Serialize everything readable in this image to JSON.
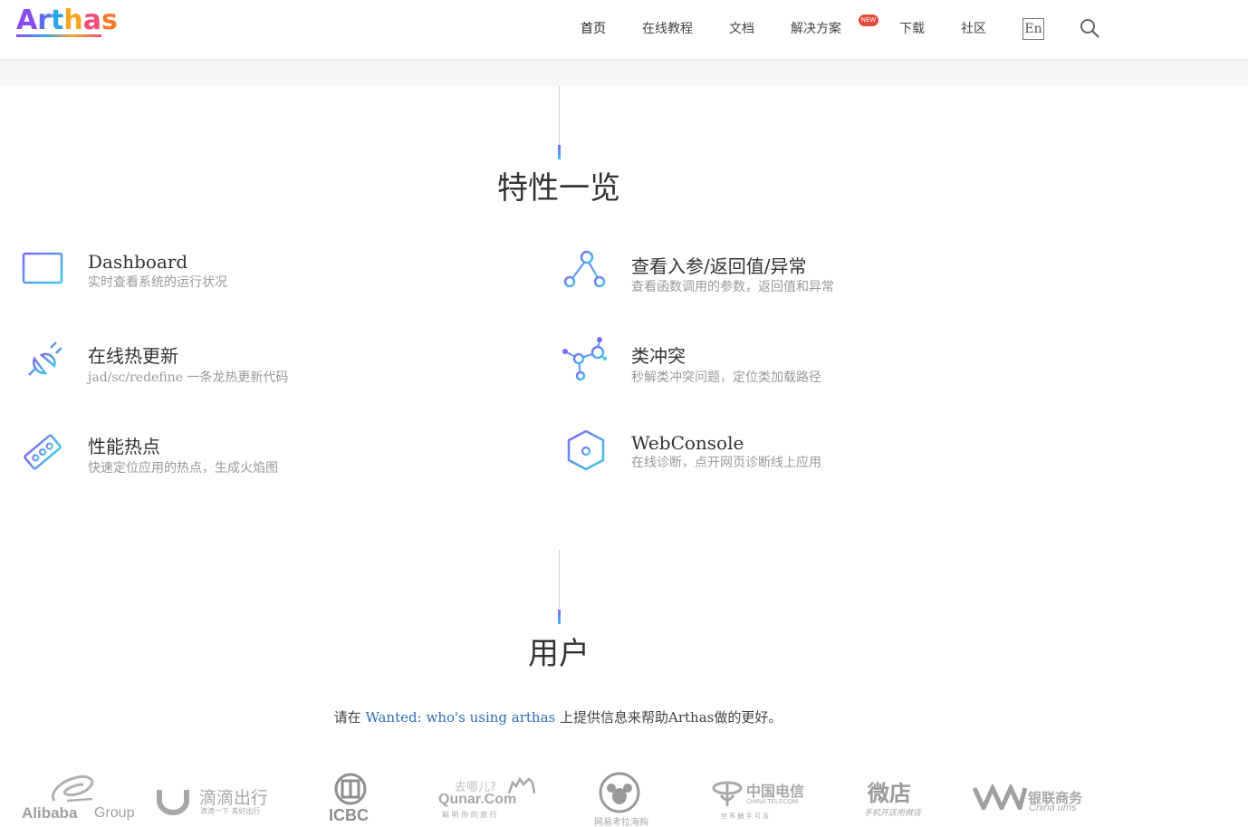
{
  "brand": {
    "name": "Arthas"
  },
  "nav": {
    "items": [
      "首页",
      "在线教程",
      "文档",
      "解决方案",
      "下载",
      "社区"
    ],
    "new_badge": "NEW",
    "lang": "En"
  },
  "features_section": {
    "title": "特性一览"
  },
  "features": [
    {
      "icon": "dashboard-icon",
      "title": "Dashboard",
      "desc": "实时查看系统的运行状况"
    },
    {
      "icon": "hot-update-icon",
      "title": "在线热更新",
      "desc": "jad/sc/redefine 一条龙热更新代码"
    },
    {
      "icon": "profiler-icon",
      "title": "性能热点",
      "desc": "快速定位应用的热点，生成火焰图"
    },
    {
      "icon": "watch-params-icon",
      "title": "查看入参/返回值/异常",
      "desc": "查看函数调用的参数，返回值和异常"
    },
    {
      "icon": "class-conflict-icon",
      "title": "类冲突",
      "desc": "秒解类冲突问题，定位类加载路径"
    },
    {
      "icon": "webconsole-icon",
      "title": "WebConsole",
      "desc": "在线诊断，点开网页诊断线上应用"
    }
  ],
  "users_section": {
    "title": "用户",
    "note_prefix": "请在 ",
    "note_link": "Wanted: who's using arthas",
    "note_suffix": " 上提供信息来帮助Arthas做的更好。"
  },
  "user_logos": {
    "alibaba": {
      "main": "Alibaba",
      "sub": "Group"
    },
    "didi": {
      "main": "滴滴出行",
      "sub": "滴滴一下 美好出行"
    },
    "icbc": {
      "main": "ICBC"
    },
    "qunar": {
      "top": "去哪儿?",
      "main": "Qunar.Com",
      "sub": "聪 明 你 的 旅 行"
    },
    "kaola": {
      "main": "网易考拉海购"
    },
    "telecom": {
      "main": "中国电信",
      "sub": "CHINA TELECOM",
      "slogan": "世 界 触 手 可 及"
    },
    "weidian": {
      "main": "微店",
      "sub": "手机开店用微店"
    },
    "ums": {
      "main": "银联商务",
      "sub": "China ums"
    }
  },
  "colors": {
    "accent_purple": "#7a6cf5",
    "accent_blue": "#3fb6e8",
    "badge_red": "#e6493c",
    "link": "#2c6fb7"
  }
}
